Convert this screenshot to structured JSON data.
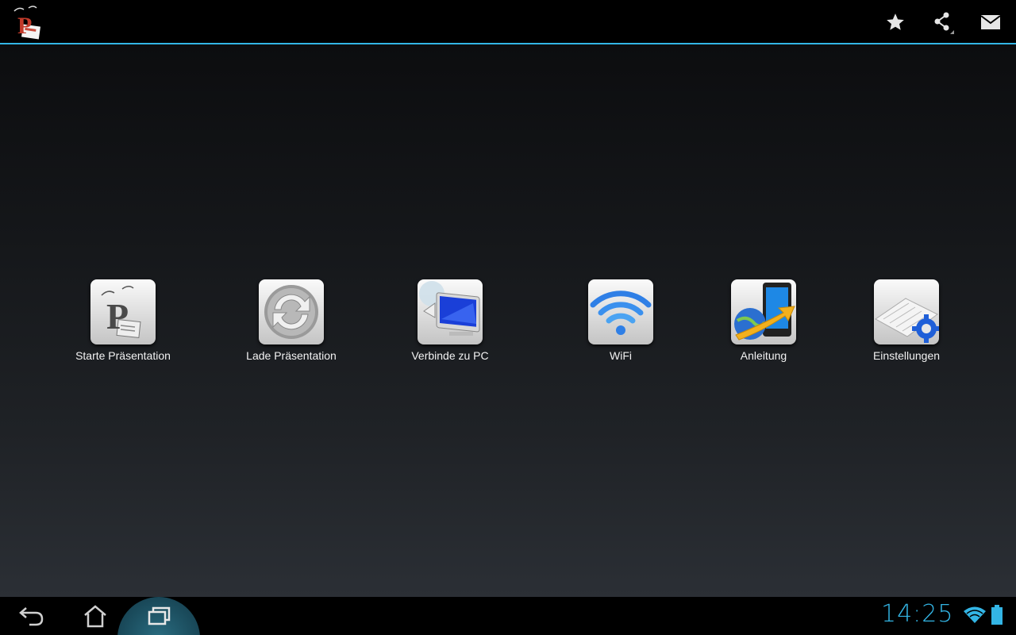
{
  "action_bar": {
    "app_icon": "presentation-p-icon",
    "actions": [
      {
        "name": "star-icon"
      },
      {
        "name": "share-icon"
      },
      {
        "name": "mail-icon"
      }
    ],
    "accent_color": "#33b5e5"
  },
  "menu": {
    "items": [
      {
        "label": "Starte Präsentation",
        "icon": "presentation-icon"
      },
      {
        "label": "Lade Präsentation",
        "icon": "reload-icon"
      },
      {
        "label": "Verbinde zu PC",
        "icon": "computer-icon"
      },
      {
        "label": "WiFi",
        "icon": "wifi-icon"
      },
      {
        "label": "Anleitung",
        "icon": "guide-icon"
      },
      {
        "label": "Einstellungen",
        "icon": "settings-icon"
      }
    ]
  },
  "system_bar": {
    "time": "14:25",
    "accent_color": "#33b5e5",
    "buttons": [
      "back-icon",
      "home-icon",
      "recent-apps-icon"
    ]
  }
}
